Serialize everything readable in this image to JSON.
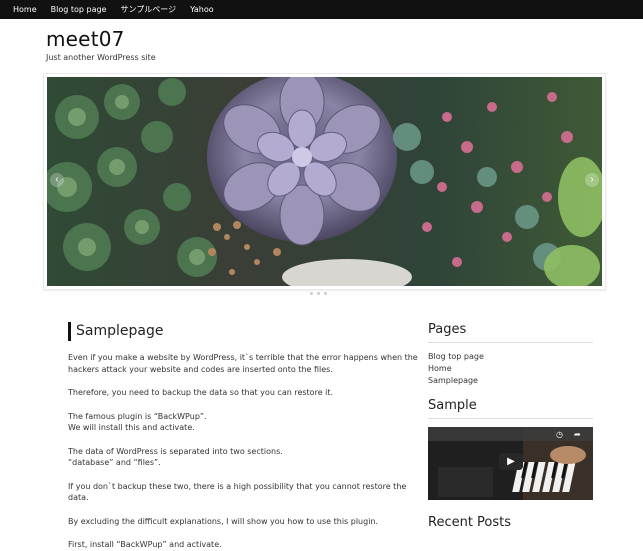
{
  "nav": {
    "items": [
      {
        "label": "Home"
      },
      {
        "label": "Blog top page"
      },
      {
        "label": "サンプルページ"
      },
      {
        "label": "Yahoo"
      }
    ]
  },
  "site": {
    "title": "meet07",
    "description": "Just another WordPress site"
  },
  "slider": {
    "prev_icon": "chevron-left-icon",
    "next_icon": "chevron-right-icon",
    "prev_glyph": "‹",
    "next_glyph": "›"
  },
  "post": {
    "title": "Samplepage",
    "paragraphs": [
      "Even if you make a website by WordPress, it`s terrible that the error happens when the hackers attack your website and codes are inserted onto the files.",
      "Therefore, you need to backup the data so that you can restore it.",
      "The famous plugin is “BackWPup”.",
      "We will install this and activate.",
      "The data of WordPress is separated into two sections.",
      "“database” and “files”.",
      "If you don`t backup these two, there is a high possibility that you cannot restore the data.",
      "By excluding the difficult explanations, I will show you how to use this plugin.",
      "First, install “BackWPup” and activate."
    ]
  },
  "sidebar": {
    "pages_title": "Pages",
    "pages": [
      {
        "label": "Blog top page"
      },
      {
        "label": "Home"
      },
      {
        "label": "Samplepage"
      }
    ],
    "sample_title": "Sample",
    "video": {
      "clock_icon": "clock-icon",
      "share_icon": "share-icon",
      "play_icon": "play-icon",
      "clock_glyph": "◷",
      "share_glyph": "➦",
      "play_glyph": "▶"
    },
    "recent_title": "Recent Posts"
  },
  "colors": {
    "nav_bg": "#111111",
    "title_bar": "#111111"
  }
}
